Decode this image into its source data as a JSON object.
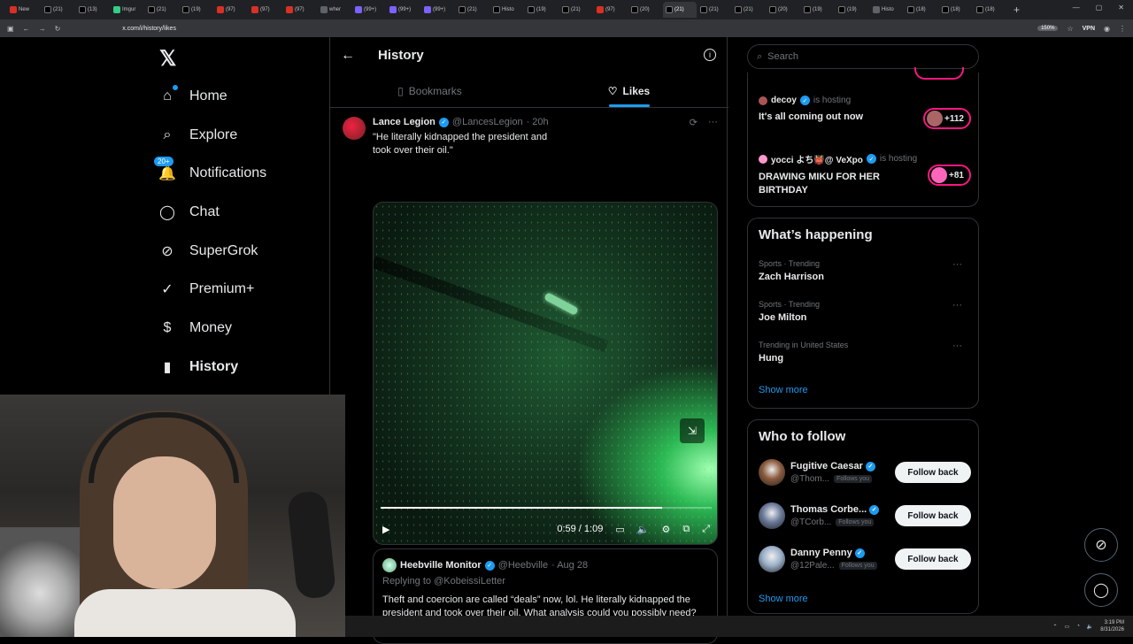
{
  "browser": {
    "tabs": [
      {
        "label": "New",
        "fav": "r"
      },
      {
        "label": "(21)",
        "fav": "x"
      },
      {
        "label": "(13)",
        "fav": "x"
      },
      {
        "label": "Imgur",
        "fav": "g"
      },
      {
        "label": "(21)",
        "fav": "x"
      },
      {
        "label": "(19)",
        "fav": "x"
      },
      {
        "label": "(97)",
        "fav": "r"
      },
      {
        "label": "(97)",
        "fav": "r"
      },
      {
        "label": "(97)",
        "fav": "r"
      },
      {
        "label": "wher",
        "fav": ""
      },
      {
        "label": "(99+)",
        "fav": "p"
      },
      {
        "label": "(99+)",
        "fav": "p"
      },
      {
        "label": "(99+)",
        "fav": "p"
      },
      {
        "label": "(21)",
        "fav": "x"
      },
      {
        "label": "Histo",
        "fav": "x"
      },
      {
        "label": "(19)",
        "fav": "x"
      },
      {
        "label": "(21)",
        "fav": "x"
      },
      {
        "label": "(97)",
        "fav": "r"
      },
      {
        "label": "(20)",
        "fav": "x"
      },
      {
        "label": "(21)",
        "fav": "x",
        "active": true
      },
      {
        "label": "(21)",
        "fav": "x"
      },
      {
        "label": "(21)",
        "fav": "x"
      },
      {
        "label": "(20)",
        "fav": "x"
      },
      {
        "label": "(19)",
        "fav": "x"
      },
      {
        "label": "(19)",
        "fav": "x"
      },
      {
        "label": "Histo",
        "fav": ""
      },
      {
        "label": "(18)",
        "fav": "x"
      },
      {
        "label": "(18)",
        "fav": "x"
      },
      {
        "label": "(18)",
        "fav": "x"
      }
    ],
    "url": "x.com/i/history/likes",
    "zoom": "150%",
    "vpn": "VPN"
  },
  "nav": {
    "items": [
      {
        "label": "Home",
        "icon": "home-icon",
        "glyph": "⌂"
      },
      {
        "label": "Explore",
        "icon": "search-icon",
        "glyph": "⌕"
      },
      {
        "label": "Notifications",
        "icon": "bell-icon",
        "glyph": "🔔",
        "badge": "20+"
      },
      {
        "label": "Chat",
        "icon": "chat-icon",
        "glyph": "◯"
      },
      {
        "label": "SuperGrok",
        "icon": "grok-icon",
        "glyph": "⊘"
      },
      {
        "label": "Premium+",
        "icon": "premium-icon",
        "glyph": "✓"
      },
      {
        "label": "Money",
        "icon": "money-icon",
        "glyph": "$"
      },
      {
        "label": "History",
        "icon": "bookmark-icon",
        "glyph": "▮",
        "active": true
      }
    ]
  },
  "header": {
    "title": "History"
  },
  "tabs": {
    "bookmarks": "Bookmarks",
    "likes": "Likes"
  },
  "post": {
    "name": "Lance Legion",
    "handle": "@LancesLegion",
    "time": "· 20h",
    "text": "\"He literally kidnapped the president and took over their oil.\"",
    "video": {
      "time": "0:59 / 1:09",
      "progress": 0.85
    }
  },
  "quote": {
    "name": "Heebville Monitor",
    "handle": "@Heebville",
    "time": "· Aug 28",
    "reply": "Replying to @KobeissiLetter",
    "text": "Theft and coercion are called “deals” now, lol. He literally kidnapped the president and took over their oil. What analysis could you possibly need?"
  },
  "right": {
    "search_placeholder": "Search",
    "spaces": [
      {
        "host": "decoy",
        "hosting": "is hosting",
        "title": "It's all coming out now",
        "count": "+112"
      },
      {
        "host": "yocci よち👹@ VeXpo",
        "hosting": "is hosting",
        "title": "DRAWING MIKU FOR HER BIRTHDAY",
        "count": "+81"
      }
    ],
    "happening": {
      "title": "What’s happening",
      "trends": [
        {
          "ctx": "Sports · Trending",
          "topic": "Zach Harrison"
        },
        {
          "ctx": "Sports · Trending",
          "topic": "Joe Milton"
        },
        {
          "ctx": "Trending in United States",
          "topic": "Hung"
        }
      ],
      "show_more": "Show more"
    },
    "who": {
      "title": "Who to follow",
      "people": [
        {
          "name": "Fugitive Caesar",
          "handle": "@Thom...",
          "follows": "Follows you",
          "button": "Follow back",
          "color": "#8a5a3c"
        },
        {
          "name": "Thomas Corbe...",
          "handle": "@TCorb...",
          "follows": "Follows you",
          "button": "Follow back",
          "color": "#6a7a9a"
        },
        {
          "name": "Danny Penny",
          "handle": "@12Pale...",
          "follows": "Follows you",
          "button": "Follow back",
          "color": "#9ab0c8"
        }
      ],
      "show_more": "Show more"
    }
  },
  "taskbar": {
    "time": "3:19 PM",
    "date": "8/31/2026"
  }
}
